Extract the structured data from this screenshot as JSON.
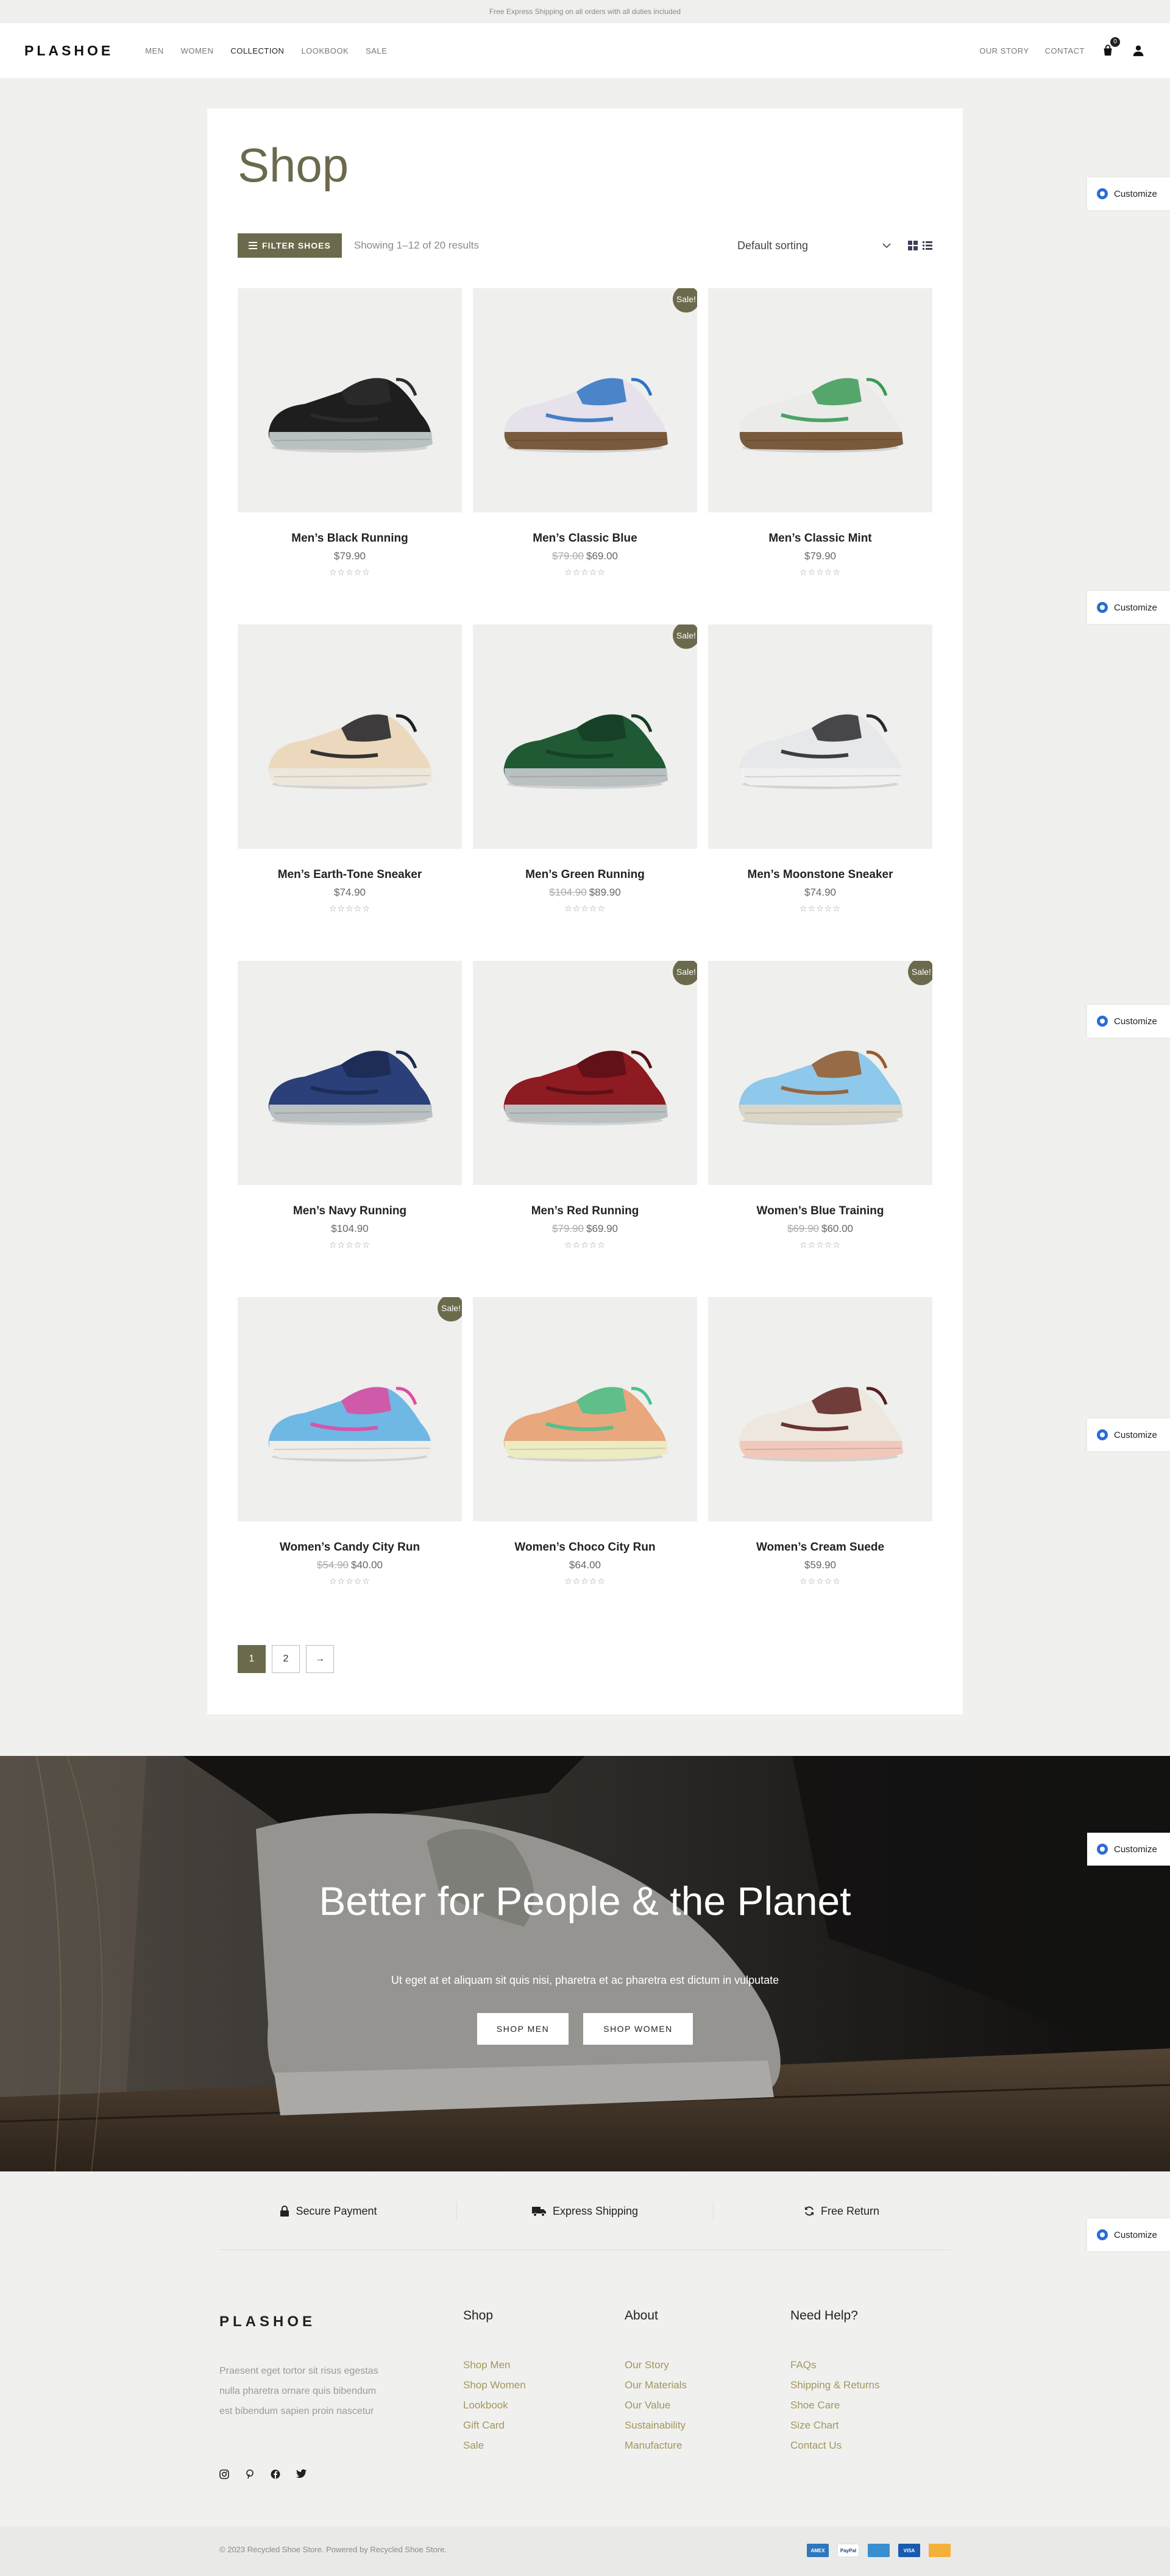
{
  "topbar": {
    "text": "Free Express Shipping on all orders with all duties included"
  },
  "header": {
    "logo": "PLASHOE",
    "nav": [
      "MEN",
      "WOMEN",
      "COLLECTION",
      "LOOKBOOK",
      "SALE"
    ],
    "active_nav": "COLLECTION",
    "right_nav": [
      "OUR STORY",
      "CONTACT"
    ],
    "cart_count": "0"
  },
  "shop": {
    "title": "Shop",
    "filter_label": "FILTER SHOES",
    "result_count": "Showing 1–12 of 20 results",
    "sorting": "Default sorting"
  },
  "products": [
    {
      "name": "Men’s Black Running",
      "price": "$79.90",
      "old_price": "",
      "sale": false,
      "colors": {
        "upper": "#1e1e1e",
        "sole": "#b9c0c2",
        "accent": "#2c2c2c"
      }
    },
    {
      "name": "Men’s Classic Blue",
      "price": "$69.00",
      "old_price": "$79.00",
      "sale": true,
      "colors": {
        "upper": "#e6e1ea",
        "sole": "#7a5a3c",
        "accent": "#2f73c2"
      }
    },
    {
      "name": "Men’s Classic Mint",
      "price": "$79.90",
      "old_price": "",
      "sale": false,
      "colors": {
        "upper": "#ebebea",
        "sole": "#7a5a3c",
        "accent": "#3b9a55"
      }
    },
    {
      "name": "Men’s Earth-Tone Sneaker",
      "price": "$74.90",
      "old_price": "",
      "sale": false,
      "colors": {
        "upper": "#ecd9bd",
        "sole": "#ede6dc",
        "accent": "#1f1f24"
      }
    },
    {
      "name": "Men’s Green Running",
      "price": "$89.90",
      "old_price": "$104.90",
      "sale": true,
      "colors": {
        "upper": "#1f5a35",
        "sole": "#b9c0c2",
        "accent": "#163d24"
      }
    },
    {
      "name": "Men’s Moonstone Sneaker",
      "price": "$74.90",
      "old_price": "",
      "sale": false,
      "colors": {
        "upper": "#e7e8ea",
        "sole": "#f0f0f0",
        "accent": "#2a2a2e"
      }
    },
    {
      "name": "Men’s Navy Running",
      "price": "$104.90",
      "old_price": "",
      "sale": false,
      "colors": {
        "upper": "#2b3f78",
        "sole": "#b9c0c2",
        "accent": "#1c2a52"
      }
    },
    {
      "name": "Men’s Red Running",
      "price": "$69.90",
      "old_price": "$79.90",
      "sale": true,
      "colors": {
        "upper": "#8e1a22",
        "sole": "#b9c0c2",
        "accent": "#5a1016"
      }
    },
    {
      "name": "Women’s Blue Training",
      "price": "$60.00",
      "old_price": "$69.90",
      "sale": true,
      "colors": {
        "upper": "#8ec8ea",
        "sole": "#dcd6c8",
        "accent": "#9a5a2a"
      }
    },
    {
      "name": "Women’s Candy City Run",
      "price": "$40.00",
      "old_price": "$54.90",
      "sale": true,
      "colors": {
        "upper": "#6fb7e5",
        "sole": "#f0ede8",
        "accent": "#e24aa0"
      }
    },
    {
      "name": "Women’s Choco City Run",
      "price": "$64.00",
      "old_price": "",
      "sale": false,
      "colors": {
        "upper": "#e8a77d",
        "sole": "#ecebc2",
        "accent": "#47c28c"
      }
    },
    {
      "name": "Women’s Cream Suede",
      "price": "$59.90",
      "old_price": "",
      "sale": false,
      "colors": {
        "upper": "#eee7dd",
        "sole": "#f1c9bb",
        "accent": "#5a1e1e"
      }
    }
  ],
  "rating_stars": "☆☆☆☆☆",
  "sale_label": "Sale!",
  "pagination": [
    "1",
    "2",
    "→"
  ],
  "customize_label": "Customize",
  "hero": {
    "title": "Better for People & the Planet",
    "subtitle": "Ut eget at et aliquam sit quis nisi, pharetra et ac pharetra est dictum in vulputate",
    "btn_men": "SHOP MEN",
    "btn_women": "SHOP WOMEN"
  },
  "features": [
    "Secure Payment",
    "Express Shipping",
    "Free Return"
  ],
  "footer": {
    "logo": "PLASHOE",
    "description": "Praesent eget tortor sit risus egestas nulla pharetra ornare quis bibendum est bibendum sapien proin nascetur",
    "columns": [
      {
        "title": "Shop",
        "links": [
          "Shop Men",
          "Shop Women",
          "Lookbook",
          "Gift Card",
          "Sale"
        ]
      },
      {
        "title": "About",
        "links": [
          "Our Story",
          "Our Materials",
          "Our Value",
          "Sustainability",
          "Manufacture"
        ]
      },
      {
        "title": "Need Help?",
        "links": [
          "FAQs",
          "Shipping & Returns",
          "Shoe Care",
          "Size Chart",
          "Contact Us"
        ]
      }
    ],
    "copyright": "© 2023 Recycled Shoe Store. Powered by Recycled Shoe Store.",
    "payments": [
      "AMEX",
      "PayPal",
      "",
      "VISA",
      ""
    ]
  },
  "colors": {
    "accent": "#6b6a4c",
    "link": "#a3965c"
  }
}
